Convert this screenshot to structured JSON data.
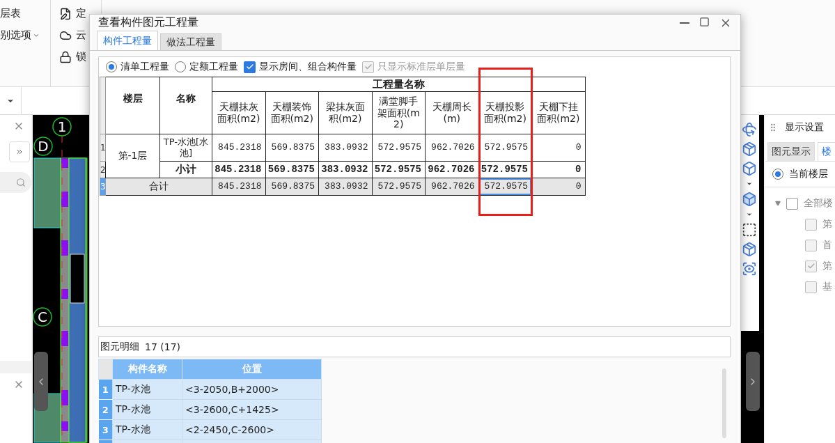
{
  "app": {
    "ribbon_left": [
      {
        "label": "层表",
        "dropdown": false
      },
      {
        "label": "别选项",
        "dropdown": true
      }
    ],
    "ribbon_tools": [
      "定",
      "云",
      "锁"
    ],
    "axis_labels": [
      "1",
      "D",
      "C"
    ],
    "display_panel": {
      "title": "显示设置",
      "tabs": [
        {
          "label": "图元显示",
          "selected": false
        },
        {
          "label": "楼",
          "selected": true
        }
      ],
      "scope_option": {
        "label": "当前楼层",
        "selected": true
      },
      "tree": {
        "label": "全部楼",
        "checked": false,
        "expanded": true,
        "children": [
          {
            "label": "第",
            "checked": false
          },
          {
            "label": "首",
            "checked": false
          },
          {
            "label": "第",
            "checked": true
          },
          {
            "label": "基",
            "checked": false
          }
        ]
      }
    }
  },
  "dialog": {
    "title": "查看构件图元工程量",
    "tabs": [
      {
        "label": "构件工程量",
        "selected": true
      },
      {
        "label": "做法工程量",
        "selected": false
      }
    ],
    "options": [
      {
        "kind": "radio",
        "label": "清单工程量",
        "selected": true
      },
      {
        "kind": "radio",
        "label": "定额工程量",
        "selected": false
      },
      {
        "kind": "checkbox",
        "label": "显示房间、组合构件量",
        "checked": true,
        "disabled": false
      },
      {
        "kind": "checkbox",
        "label": "只显示标准层单层量",
        "checked": true,
        "disabled": true
      }
    ],
    "quantity_table": {
      "floor_header": "楼层",
      "name_header": "名称",
      "group_header": "工程量名称",
      "columns": [
        "天棚抹灰面积(m2)",
        "天棚装饰面积(m2)",
        "梁抹灰面积(m2)",
        "满堂脚手架面积(m2)",
        "天棚周长(m)",
        "天棚投影面积(m2)",
        "天棚下挂面积(m2)"
      ],
      "rows": [
        {
          "number": "1",
          "kind": "item",
          "selected": false,
          "floor": "第-1层",
          "name": "TP-水池[水池]",
          "cells": [
            {
              "value": "845.2318",
              "selected": false
            },
            {
              "value": "569.8375",
              "selected": false
            },
            {
              "value": "383.0932",
              "selected": false
            },
            {
              "value": "572.9575",
              "selected": false
            },
            {
              "value": "962.7026",
              "selected": false
            },
            {
              "value": "572.9575",
              "selected": false
            },
            {
              "value": "0",
              "selected": false
            }
          ]
        },
        {
          "number": "2",
          "kind": "subtotal",
          "selected": false,
          "name": "小计",
          "cells": [
            {
              "value": "845.2318",
              "selected": false
            },
            {
              "value": "569.8375",
              "selected": false
            },
            {
              "value": "383.0932",
              "selected": false
            },
            {
              "value": "572.9575",
              "selected": false
            },
            {
              "value": "962.7026",
              "selected": false
            },
            {
              "value": "572.9575",
              "selected": false
            },
            {
              "value": "0",
              "selected": false
            }
          ]
        },
        {
          "number": "3",
          "kind": "total",
          "selected": true,
          "name": "合计",
          "cells": [
            {
              "value": "845.2318",
              "selected": false
            },
            {
              "value": "569.8375",
              "selected": false
            },
            {
              "value": "383.0932",
              "selected": false
            },
            {
              "value": "572.9575",
              "selected": false
            },
            {
              "value": "962.7026",
              "selected": false
            },
            {
              "value": "572.9575",
              "selected": true
            },
            {
              "value": "0",
              "selected": false
            }
          ]
        }
      ]
    },
    "detail": {
      "title": "图元明细",
      "count": "17 (17)",
      "columns": [
        "构件名称",
        "位置"
      ],
      "rows": [
        {
          "number": "1",
          "name": "TP-水池",
          "position": "<3-2050,B+2000>",
          "selected": true
        },
        {
          "number": "2",
          "name": "TP-水池",
          "position": "<3-2600,C+1425>",
          "selected": true
        },
        {
          "number": "3",
          "name": "TP-水池",
          "position": "<2-2450,C-2600>",
          "selected": true
        }
      ]
    }
  }
}
